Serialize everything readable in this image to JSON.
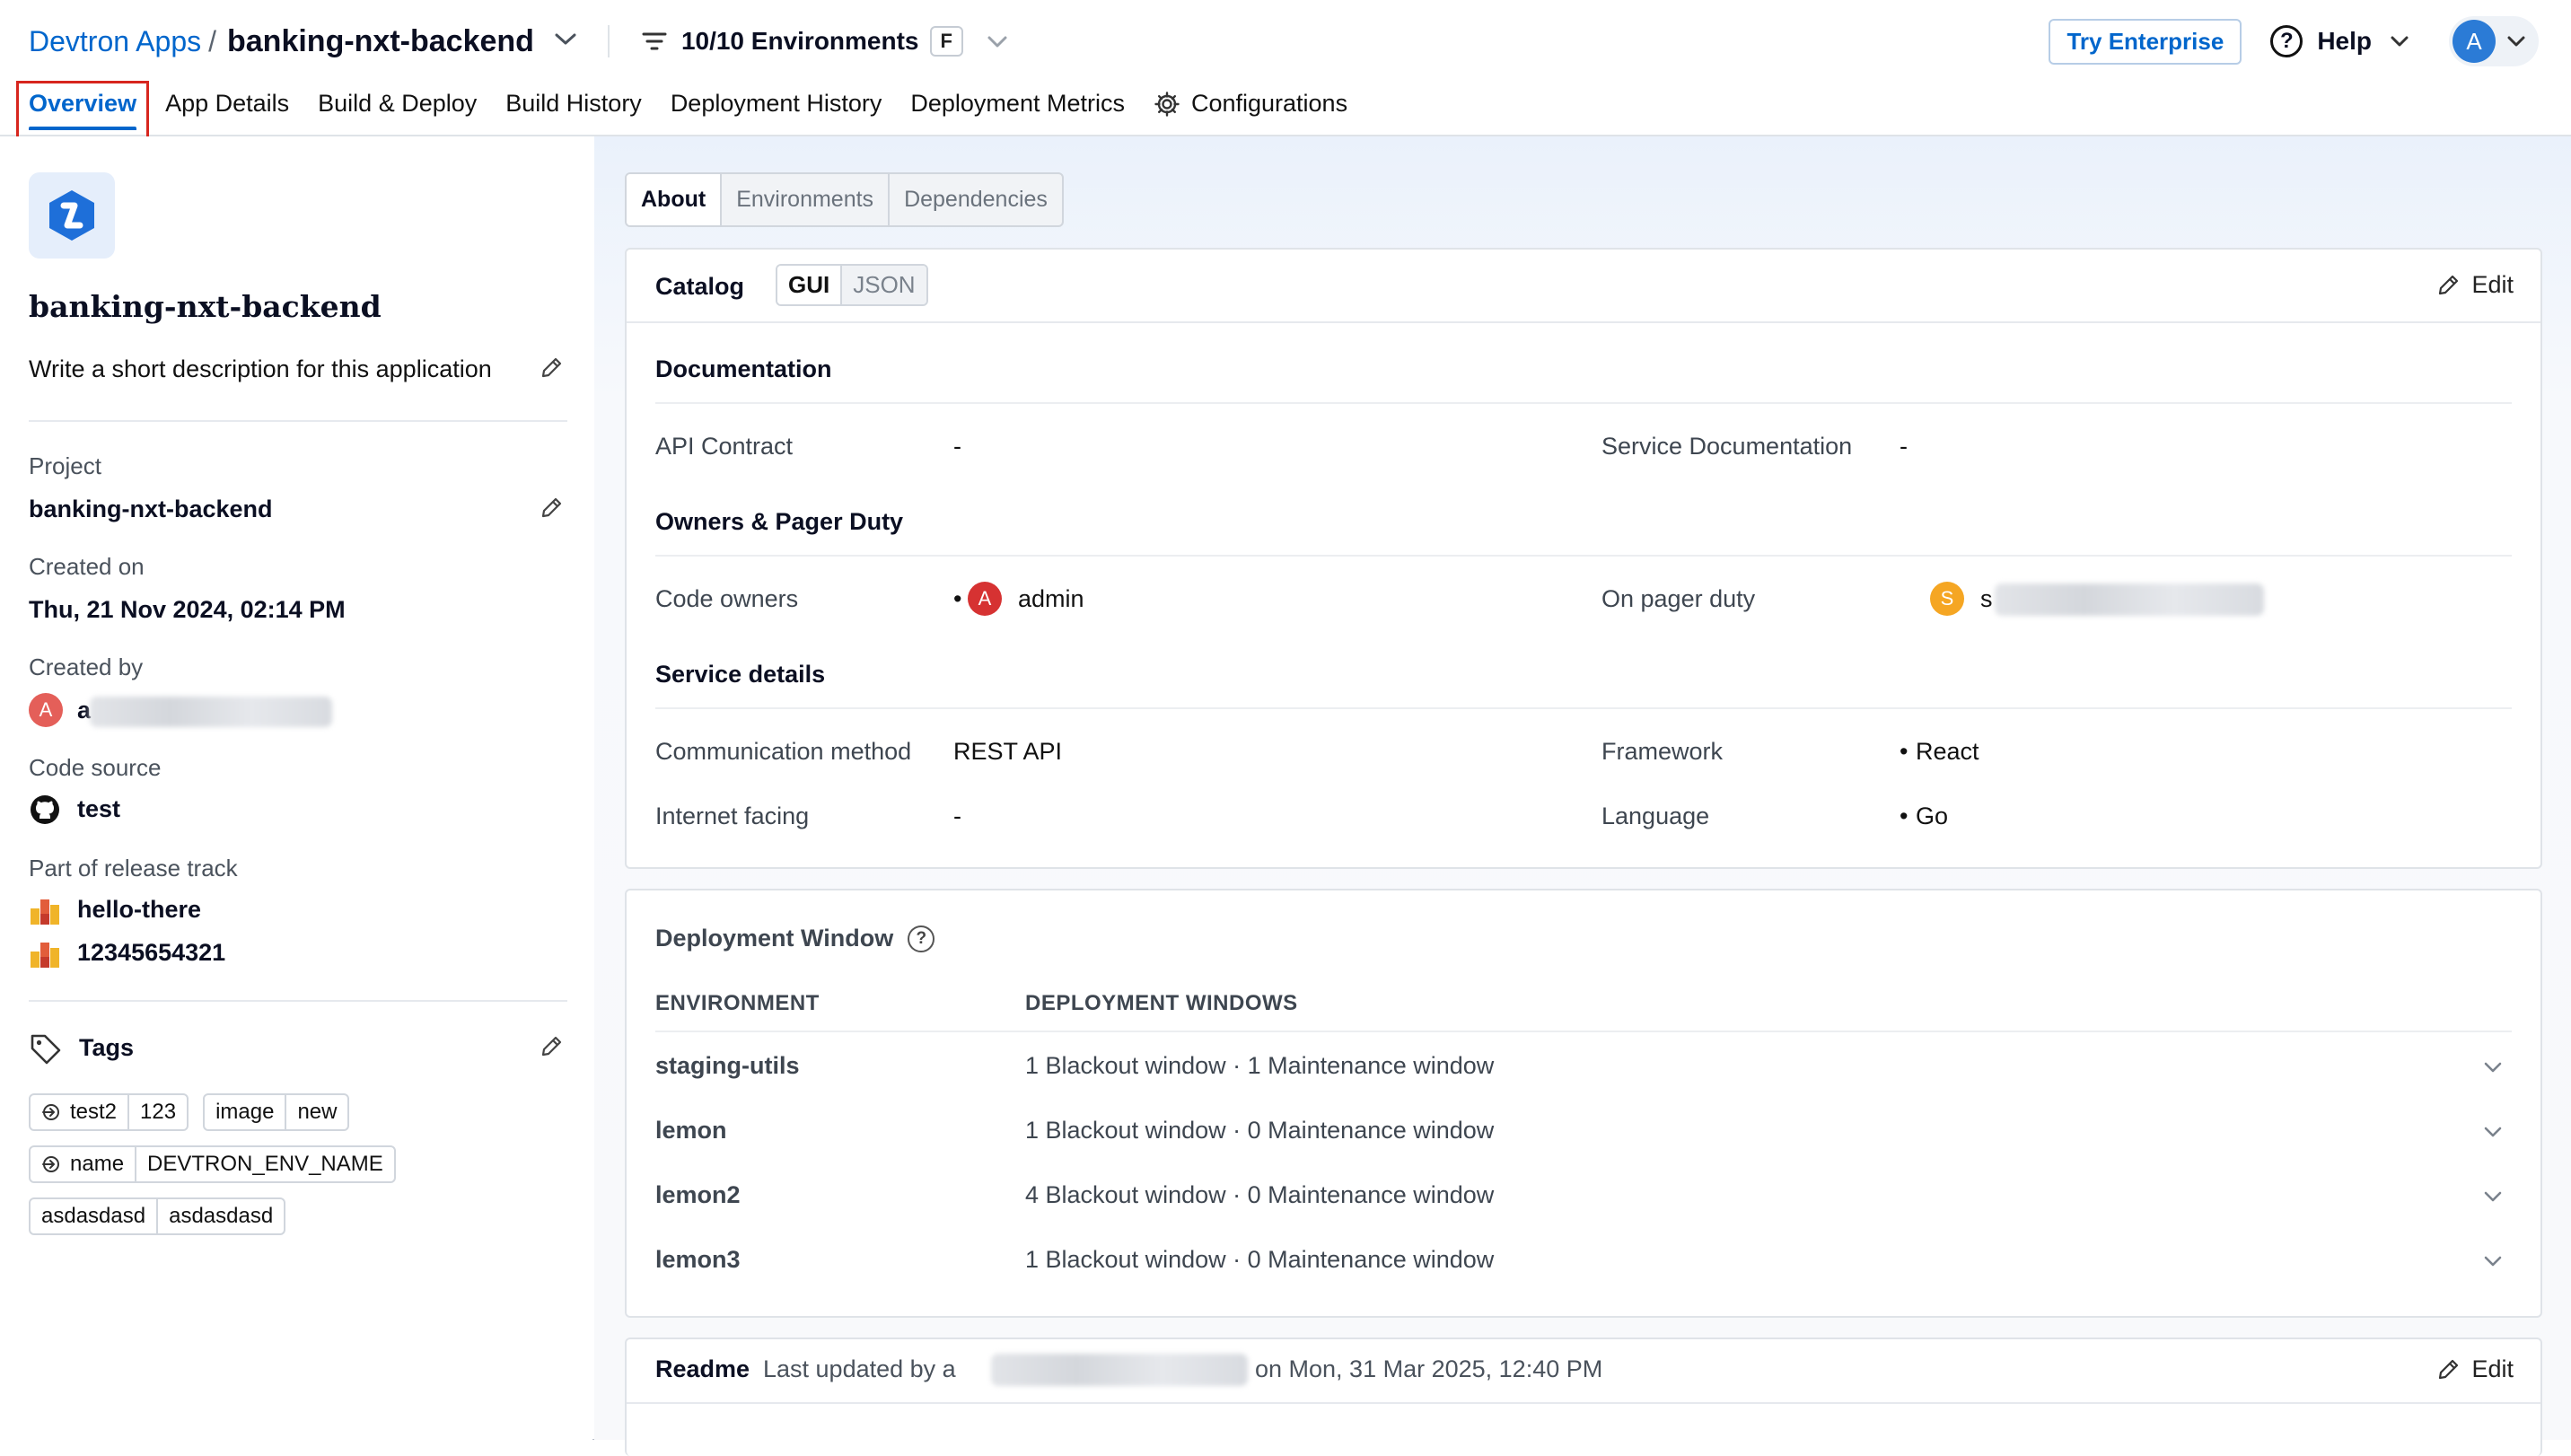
{
  "header": {
    "breadcrumb_root": "Devtron Apps",
    "separator": "/",
    "app_name": "banking-nxt-backend",
    "env_filter_label": "10/10 Environments",
    "env_filter_shortcut": "F",
    "try_enterprise": "Try Enterprise",
    "help": "Help",
    "avatar_initial": "A"
  },
  "tabs": [
    {
      "label": "Overview",
      "active": true
    },
    {
      "label": "App Details"
    },
    {
      "label": "Build & Deploy"
    },
    {
      "label": "Build History"
    },
    {
      "label": "Deployment History"
    },
    {
      "label": "Deployment Metrics"
    },
    {
      "label": "Configurations"
    }
  ],
  "left": {
    "app_title": "banking-nxt-backend",
    "description": "Write a short description for this application",
    "project_label": "Project",
    "project_value": "banking-nxt-backend",
    "created_on_label": "Created on",
    "created_on_value": "Thu, 21 Nov 2024, 02:14 PM",
    "created_by_label": "Created by",
    "created_by_initial": "A",
    "created_by_prefix": "a",
    "code_source_label": "Code source",
    "code_source_value": "test",
    "release_track_label": "Part of release track",
    "release_tracks": [
      "hello-there",
      "12345654321"
    ],
    "tags_label": "Tags",
    "tags": [
      {
        "key": "test2",
        "value": "123",
        "propagate": true
      },
      {
        "key": "image",
        "value": "new",
        "propagate": false
      },
      {
        "key": "name",
        "value": "DEVTRON_ENV_NAME",
        "propagate": true
      },
      {
        "key": "asdasdasd",
        "value": "asdasdasd",
        "propagate": false
      }
    ]
  },
  "right": {
    "subtabs": [
      "About",
      "Environments",
      "Dependencies"
    ],
    "catalog": {
      "title": "Catalog",
      "gui": "GUI",
      "json": "JSON",
      "edit": "Edit",
      "documentation_title": "Documentation",
      "api_contract_label": "API Contract",
      "api_contract_value": "-",
      "service_doc_label": "Service Documentation",
      "service_doc_value": "-",
      "owners_title": "Owners & Pager Duty",
      "code_owners_label": "Code owners",
      "code_owner_initial": "A",
      "code_owner_name": "admin",
      "pager_label": "On pager duty",
      "pager_initial": "S",
      "pager_prefix": "s",
      "service_title": "Service details",
      "comm_label": "Communication method",
      "comm_value": "REST API",
      "framework_label": "Framework",
      "framework_value": "React",
      "internet_label": "Internet facing",
      "internet_value": "-",
      "language_label": "Language",
      "language_value": "Go"
    },
    "deployment_window": {
      "title": "Deployment Window",
      "col_env": "ENVIRONMENT",
      "col_windows": "DEPLOYMENT WINDOWS",
      "rows": [
        {
          "env": "staging-utils",
          "windows": "1 Blackout window · 1 Maintenance window"
        },
        {
          "env": "lemon",
          "windows": "1 Blackout window · 0 Maintenance window"
        },
        {
          "env": "lemon2",
          "windows": "4 Blackout window · 0 Maintenance window"
        },
        {
          "env": "lemon3",
          "windows": "1 Blackout window · 0 Maintenance window"
        }
      ]
    },
    "readme": {
      "title": "Readme",
      "updated_prefix": "Last updated by a",
      "updated_suffix": "on Mon, 31 Mar 2025, 12:40 PM",
      "edit": "Edit"
    }
  },
  "colors": {
    "accent": "#0066cc",
    "highlight_box": "#d7261e",
    "avatar_blue": "#2b7bd6",
    "avatar_red": "#e45f59",
    "avatar_admin": "#d63232",
    "avatar_orange": "#f5a623"
  }
}
